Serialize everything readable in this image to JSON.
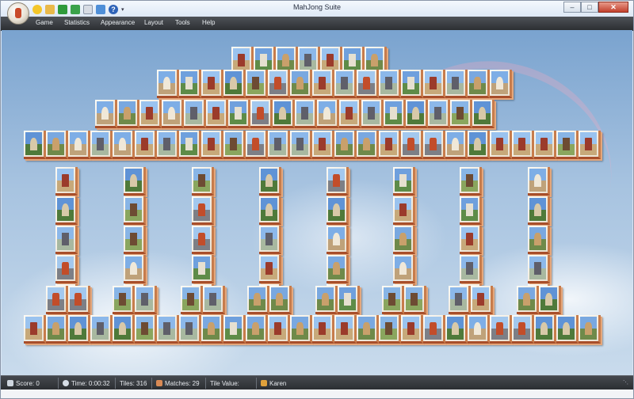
{
  "window": {
    "title": "MahJong Suite"
  },
  "quick_access": [
    "smiley-icon",
    "save-icon",
    "undo-icon",
    "redo-icon",
    "tiles-icon",
    "stats-icon",
    "help-icon",
    "customize-arrow-icon"
  ],
  "window_buttons": {
    "minimize": "–",
    "maximize": "□",
    "close": "✕"
  },
  "menu": [
    "Game",
    "Statistics",
    "Appearance",
    "Layout",
    "Tools",
    "Help"
  ],
  "status": {
    "score": "Score: 0",
    "time": "Time: 0:00:32",
    "tiles": "Tiles: 316",
    "matches": "Matches: 29",
    "tile_value": "Tile Value:",
    "player": "Karen"
  },
  "colors": {
    "tile_edge": "#c77c4c",
    "menubar": "#3a3d42",
    "sky": "#8fb3da"
  },
  "tile_theme": "world-landmarks"
}
